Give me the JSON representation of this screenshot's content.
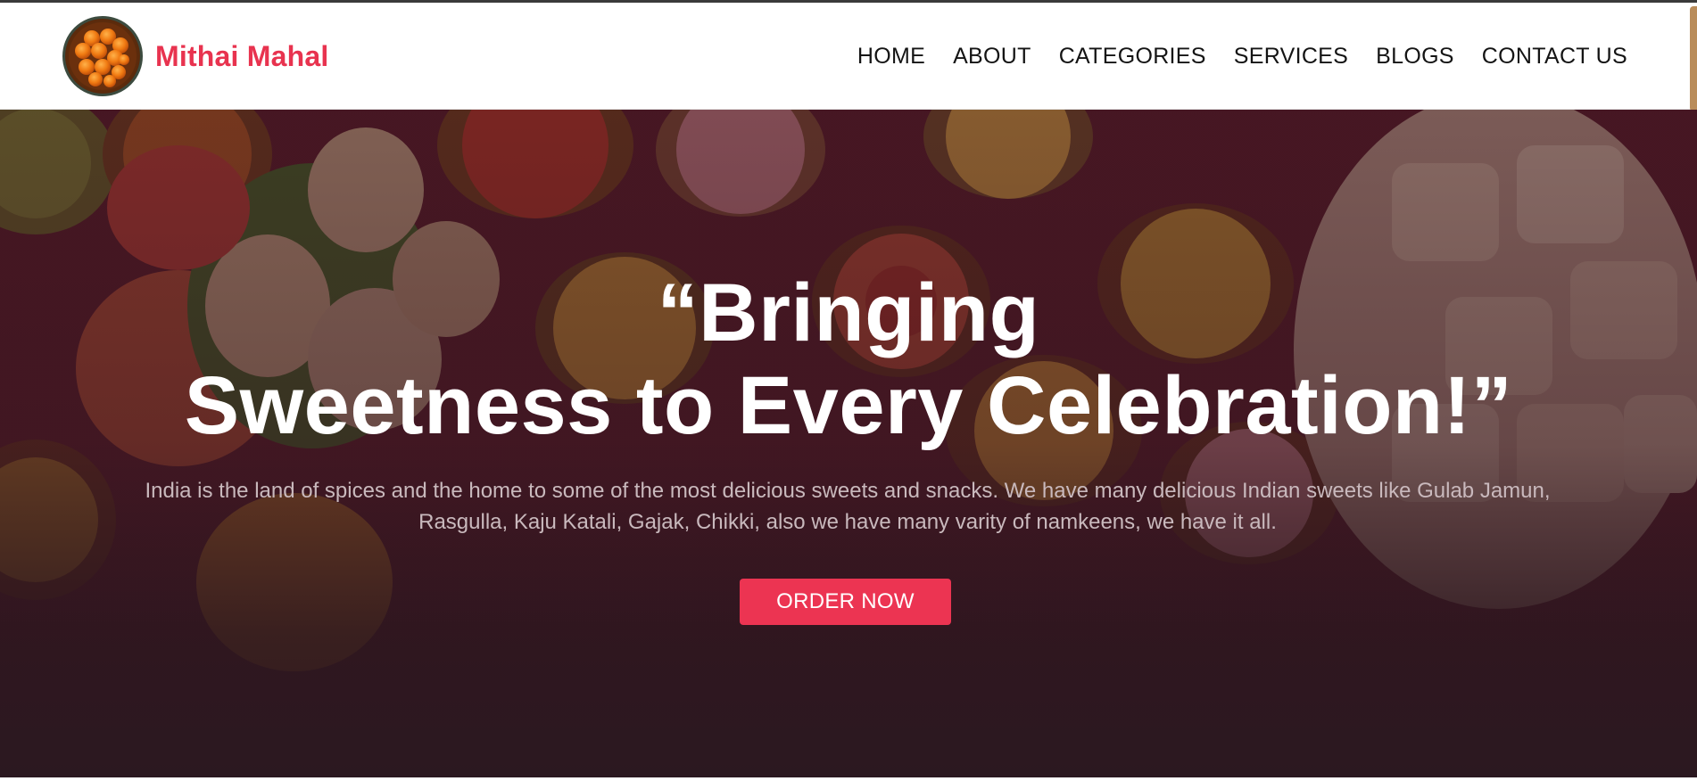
{
  "brand": {
    "name": "Mithai Mahal",
    "logo_icon": "laddoo-plate-icon"
  },
  "nav": {
    "items": [
      {
        "label": "HOME"
      },
      {
        "label": "ABOUT"
      },
      {
        "label": "CATEGORIES"
      },
      {
        "label": "SERVICES"
      },
      {
        "label": "BLOGS"
      },
      {
        "label": "CONTACT US"
      }
    ]
  },
  "hero": {
    "headline_line1": "“Bringing",
    "headline_line2": "Sweetness to Every Celebration!”",
    "description": "India is the land of spices and the home to some of the most delicious sweets and snacks. We have many delicious Indian sweets like Gulab Jamun, Rasgulla, Kaju Katali, Gajak, Chikki, also we have many varity of namkeens, we have it all.",
    "cta_label": "ORDER NOW"
  },
  "colors": {
    "brand": "#e8334f",
    "button": "#ec3452",
    "hero_overlay": "#3a1a24",
    "nav_text": "#141414"
  }
}
